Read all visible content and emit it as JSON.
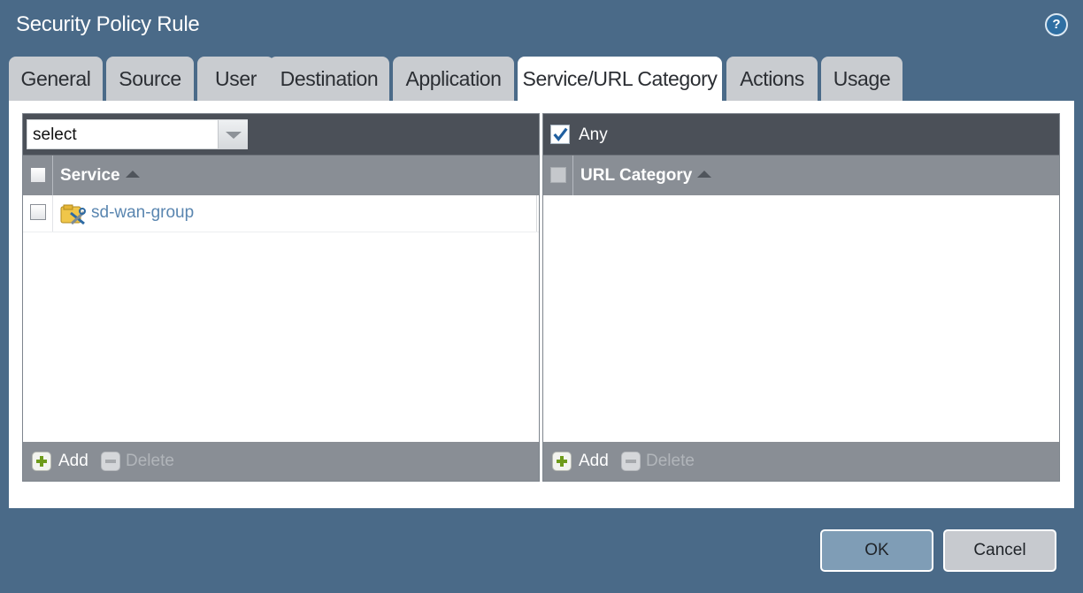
{
  "dialog": {
    "title": "Security Policy Rule"
  },
  "tabs": [
    {
      "label": "General"
    },
    {
      "label": "Source"
    },
    {
      "label": "User"
    },
    {
      "label": "Destination"
    },
    {
      "label": "Application"
    },
    {
      "label": "Service/URL Category",
      "active": true
    },
    {
      "label": "Actions"
    },
    {
      "label": "Usage"
    }
  ],
  "service_panel": {
    "select_value": "select",
    "column_header": "Service",
    "rows": [
      {
        "name": "sd-wan-group",
        "icon": "service-group-icon"
      }
    ],
    "add_label": "Add",
    "delete_label": "Delete"
  },
  "url_panel": {
    "any_label": "Any",
    "any_checked": true,
    "column_header": "URL Category",
    "rows": [],
    "add_label": "Add",
    "delete_label": "Delete"
  },
  "buttons": {
    "ok": "OK",
    "cancel": "Cancel"
  },
  "colors": {
    "background": "#4a6a88",
    "accent": "#2f6fa3",
    "link": "#5a86b0"
  },
  "icons": [
    "help-icon",
    "sort-asc-icon",
    "add-icon",
    "delete-icon",
    "checkbox-icon",
    "service-group-icon",
    "dropdown-arrow-icon"
  ]
}
